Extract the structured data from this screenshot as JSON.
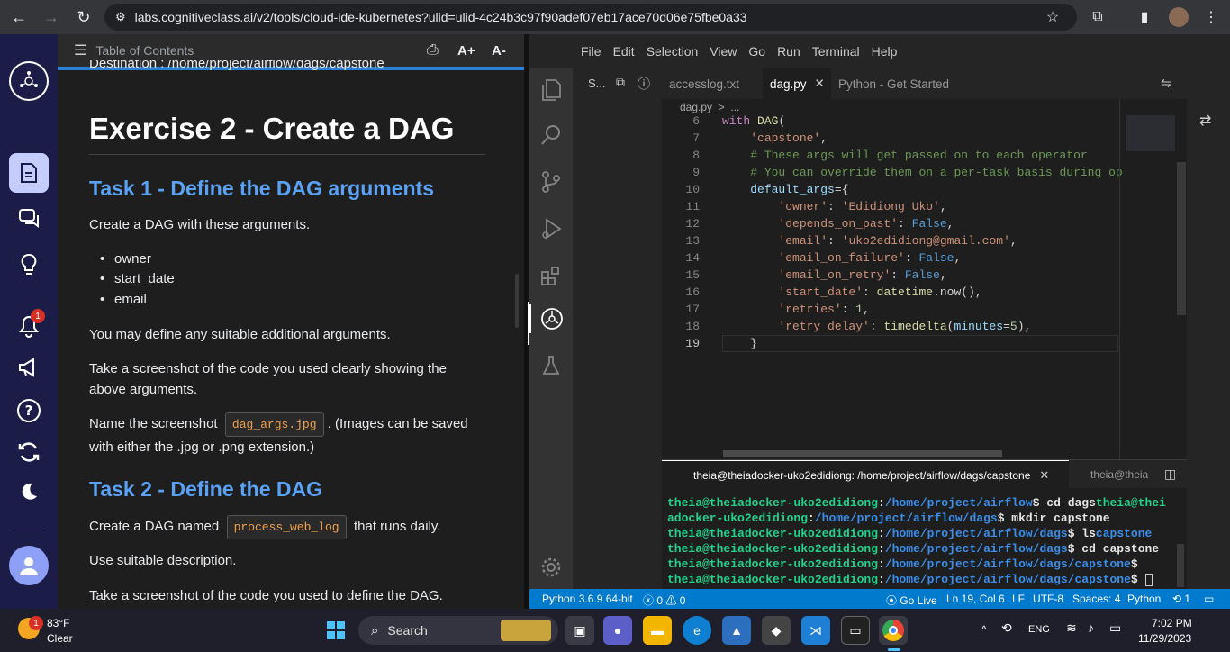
{
  "browser": {
    "url": "labs.cognitiveclass.ai/v2/tools/cloud-ide-kubernetes?ulid=ulid-4c24b3c97f90adef07eb17ace70d06e75fbe0a33"
  },
  "rail": {
    "notification_count": "1"
  },
  "doc": {
    "toolbar_label": "Table of Contents",
    "font_up": "A+",
    "font_down": "A-",
    "partial_line": "Destination : /home/project/airflow/dags/capstone",
    "exercise_title": "Exercise 2 - Create a DAG",
    "task1_title": "Task 1 - Define the DAG arguments",
    "task1_intro": "Create a DAG with these arguments.",
    "task1_args": [
      "owner",
      "start_date",
      "email"
    ],
    "task1_additional": "You may define any suitable additional arguments.",
    "task1_screenshot": "Take a screenshot of the code you used clearly showing the above arguments.",
    "task1_name_pre": "Name the screenshot",
    "task1_name_code": "dag_args.jpg",
    "task1_name_post": ". (Images can be saved with either the .jpg or .png extension.)",
    "task2_title": "Task 2 - Define the DAG",
    "task2_pre": "Create a DAG named",
    "task2_code": "process_web_log",
    "task2_post": "that runs daily.",
    "task2_desc": "Use suitable description.",
    "task2_screenshot": "Take a screenshot of the code you used to define the DAG."
  },
  "ide": {
    "menus": [
      "File",
      "Edit",
      "Selection",
      "View",
      "Go",
      "Run",
      "Terminal",
      "Help"
    ],
    "sidebar_label": "S...",
    "tabs": [
      {
        "label": "accesslog.txt"
      },
      {
        "label": "dag.py"
      },
      {
        "label": "Python - Get Started"
      }
    ],
    "breadcrumb": "dag.py  >  ...",
    "code_lines": [
      {
        "n": "6",
        "text": "with DAG("
      },
      {
        "n": "7",
        "text": "    'capstone',"
      },
      {
        "n": "8",
        "text": "    # These args will get passed on to each operator"
      },
      {
        "n": "9",
        "text": "    # You can override them on a per-task basis during op"
      },
      {
        "n": "10",
        "text": "    default_args={"
      },
      {
        "n": "11",
        "text": "        'owner': 'Edidiong Uko',"
      },
      {
        "n": "12",
        "text": "        'depends_on_past': False,"
      },
      {
        "n": "13",
        "text": "        'email': 'uko2edidiong@gmail.com',"
      },
      {
        "n": "14",
        "text": "        'email_on_failure': False,"
      },
      {
        "n": "15",
        "text": "        'email_on_retry': False,"
      },
      {
        "n": "16",
        "text": "        'start_date': datetime.now(),"
      },
      {
        "n": "17",
        "text": "        'retries': 1,"
      },
      {
        "n": "18",
        "text": "        'retry_delay': timedelta(minutes=5),"
      },
      {
        "n": "19",
        "text": "    }"
      }
    ],
    "terminal_tab": "theia@theiadocker-uko2edidiong: /home/project/airflow/dags/capstone",
    "terminal_tab2": "theia@theia",
    "terminal_lines": [
      {
        "user": "theia@theiadocker-uko2edidiong",
        "path": "/home/project/airflow",
        "cmd": "$ cd dags",
        "tail_user": "theia@thei"
      },
      {
        "user": "adocker-uko2edidiong",
        "path": "/home/project/airflow/dags",
        "cmd": "$ mkdir capstone",
        "tail_user": ""
      },
      {
        "user": "theia@theiadocker-uko2edidiong",
        "path": "/home/project/airflow/dags",
        "cmd": "$ ls",
        "tail_user": "",
        "tail_blue": "capstone"
      },
      {
        "user": "theia@theiadocker-uko2edidiong",
        "path": "/home/project/airflow/dags",
        "cmd": "$ cd capstone",
        "tail_user": ""
      },
      {
        "user": "theia@theiadocker-uko2edidiong",
        "path": "/home/project/airflow/dags/capstone",
        "cmd": "$",
        "tail_user": ""
      },
      {
        "user": "theia@theiadocker-uko2edidiong",
        "path": "/home/project/airflow/dags/capstone",
        "cmd": "$",
        "tail_user": ""
      }
    ],
    "status": {
      "python": "Python 3.6.9 64-bit",
      "problems": "0",
      "warnings": "0",
      "golive": "Go Live",
      "position": "Ln 19, Col 6",
      "eol": "LF",
      "encoding": "UTF-8",
      "spaces": "Spaces: 4",
      "language": "Python",
      "notif": "1"
    }
  },
  "taskbar": {
    "weather_temp": "83°F",
    "weather_desc": "Clear",
    "weather_badge": "1",
    "search_label": "Search",
    "lang": "ENG",
    "time": "7:02 PM",
    "date": "11/29/2023"
  }
}
